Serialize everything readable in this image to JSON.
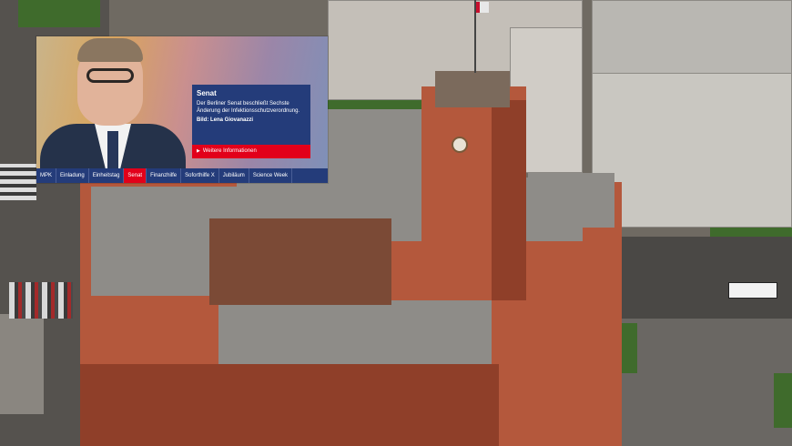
{
  "teaser": {
    "title": "Senat",
    "text": "Der Berliner Senat beschließt Sechste Änderung der Infektionsschutzverordnung.",
    "credit": "Bild: Lena Giovanazzi",
    "more_label": "Weitere Informationen",
    "more_icon": "triangle-right-icon"
  },
  "nav": {
    "active_index": 3,
    "items": [
      {
        "label": "MPK"
      },
      {
        "label": "Einladung"
      },
      {
        "label": "Einheitstag"
      },
      {
        "label": "Senat"
      },
      {
        "label": "Finanzhilfe"
      },
      {
        "label": "Soforthilfe X"
      },
      {
        "label": "Jubiläum"
      },
      {
        "label": "Science Week"
      }
    ]
  },
  "colors": {
    "nav_background": "#243c7a",
    "accent_red": "#e2001a"
  }
}
